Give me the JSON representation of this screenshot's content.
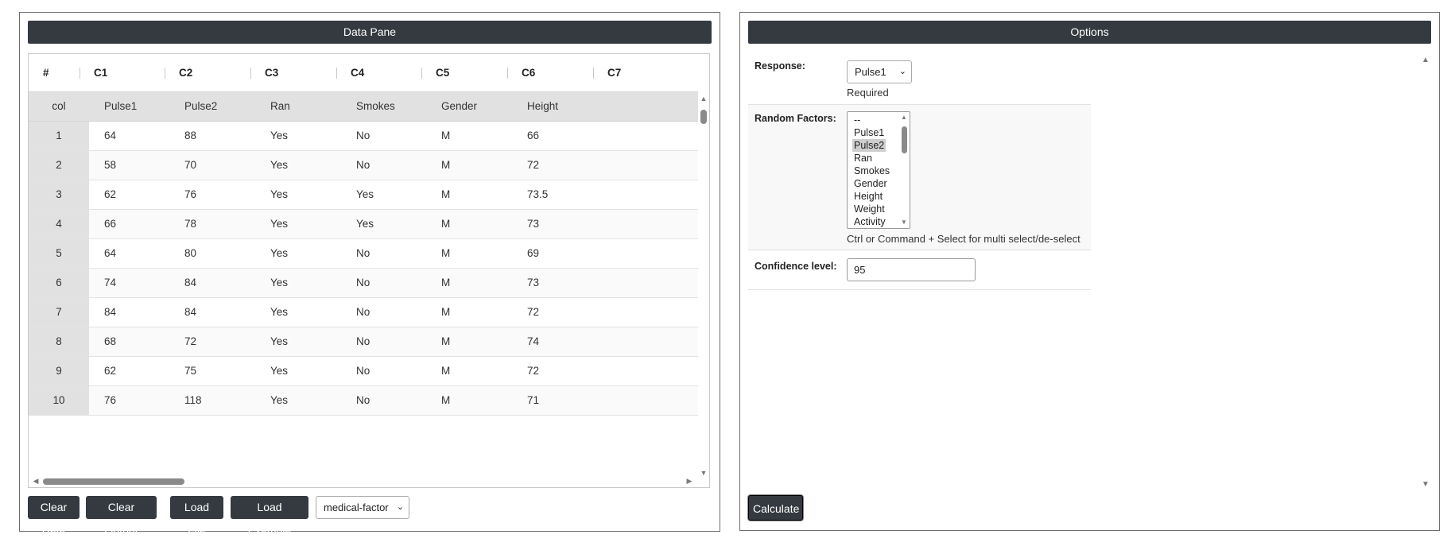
{
  "data_pane": {
    "title": "Data Pane",
    "grid": {
      "index_header": "#",
      "columns": [
        "C1",
        "C2",
        "C3",
        "C4",
        "C5",
        "C6",
        "C7"
      ],
      "col_row_label": "col",
      "column_names": [
        "Pulse1",
        "Pulse2",
        "Ran",
        "Smokes",
        "Gender",
        "Height"
      ],
      "rows": [
        {
          "index": "1",
          "cells": [
            "64",
            "88",
            "Yes",
            "No",
            "M",
            "66"
          ]
        },
        {
          "index": "2",
          "cells": [
            "58",
            "70",
            "Yes",
            "No",
            "M",
            "72"
          ]
        },
        {
          "index": "3",
          "cells": [
            "62",
            "76",
            "Yes",
            "Yes",
            "M",
            "73.5"
          ]
        },
        {
          "index": "4",
          "cells": [
            "66",
            "78",
            "Yes",
            "Yes",
            "M",
            "73"
          ]
        },
        {
          "index": "5",
          "cells": [
            "64",
            "80",
            "Yes",
            "No",
            "M",
            "69"
          ]
        },
        {
          "index": "6",
          "cells": [
            "74",
            "84",
            "Yes",
            "No",
            "M",
            "73"
          ]
        },
        {
          "index": "7",
          "cells": [
            "84",
            "84",
            "Yes",
            "No",
            "M",
            "72"
          ]
        },
        {
          "index": "8",
          "cells": [
            "68",
            "72",
            "Yes",
            "No",
            "M",
            "74"
          ]
        },
        {
          "index": "9",
          "cells": [
            "62",
            "75",
            "Yes",
            "No",
            "M",
            "72"
          ]
        },
        {
          "index": "10",
          "cells": [
            "76",
            "118",
            "Yes",
            "No",
            "M",
            "71"
          ]
        }
      ]
    },
    "buttons": {
      "clear_data": "Clear Data",
      "clear_output": "Clear Output",
      "load_file": "Load File",
      "load_example": "Load Example"
    },
    "example_select": {
      "value": "medical-factor"
    }
  },
  "options": {
    "title": "Options",
    "response": {
      "label": "Response:",
      "value": "Pulse1",
      "note": "Required"
    },
    "random_factors": {
      "label": "Random Factors:",
      "options": [
        "--",
        "Pulse1",
        "Pulse2",
        "Ran",
        "Smokes",
        "Gender",
        "Height",
        "Weight",
        "Activity"
      ],
      "selected": "Pulse2",
      "note": "Ctrl or Command + Select for multi select/de-select"
    },
    "confidence_level": {
      "label": "Confidence level:",
      "value": "95"
    },
    "calculate_label": "Calculate"
  },
  "colors": {
    "header_bg": "#343a40",
    "index_column_bg": "#e1e1e1",
    "selected_option_bg": "#cecece"
  },
  "icons": {
    "scroll_up": "up-triangle",
    "scroll_down": "down-triangle",
    "scroll_left": "left-triangle",
    "scroll_right": "right-triangle",
    "select_caret": "chevron-down"
  }
}
